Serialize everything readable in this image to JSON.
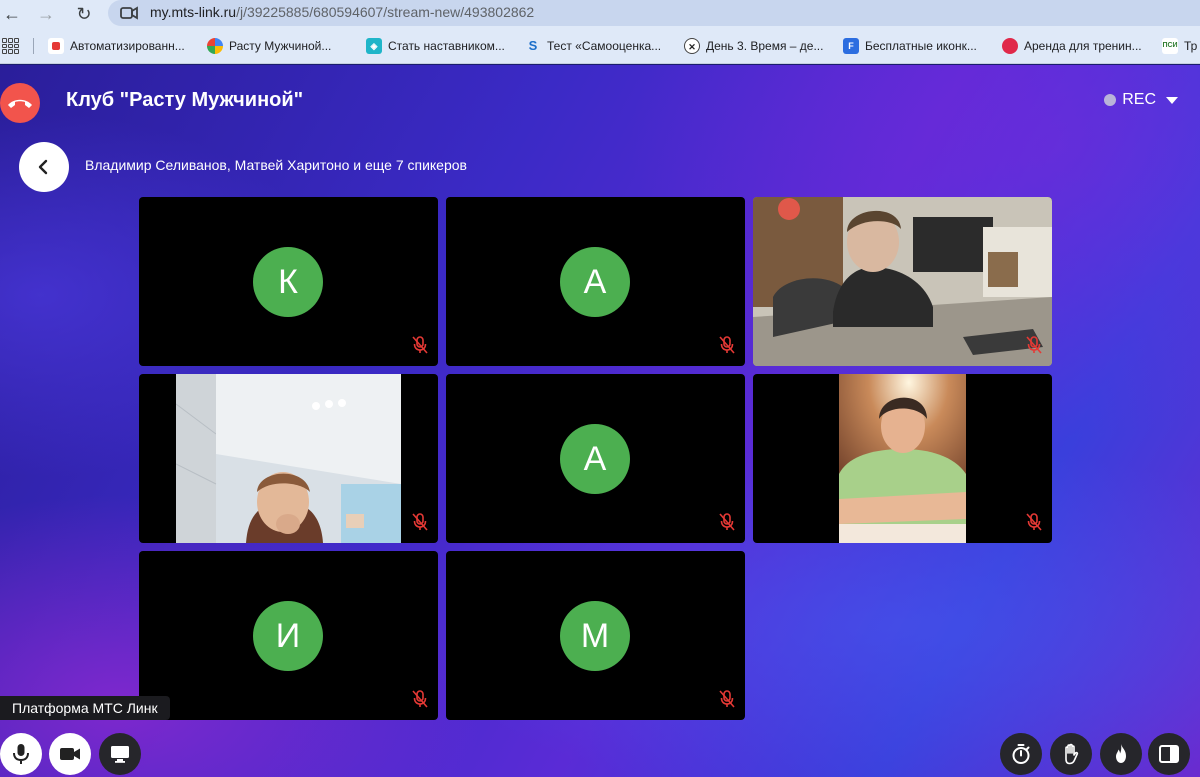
{
  "browser": {
    "url_host": "my.mts-link.ru",
    "url_path": "/j/39225885/680594607/stream-new/493802862",
    "bookmarks": [
      {
        "label": "Автоматизированн...",
        "icon": "red-dot-icon",
        "color": "#e53935"
      },
      {
        "label": "Расту Мужчиной...",
        "icon": "colorful-circle-icon",
        "color": "#4285f4"
      },
      {
        "label": "Стать наставником...",
        "icon": "cyan-logo-icon",
        "color": "#1fb5c9"
      },
      {
        "label": "Тест «Самооценка...",
        "icon": "s-logo-icon",
        "color": "#1c6fc9"
      },
      {
        "label": "День 3. Время – де...",
        "icon": "white-circle-icon",
        "color": "#ffffff"
      },
      {
        "label": "Бесплатные иконк...",
        "icon": "f-logo-icon",
        "color": "#2c6de0"
      },
      {
        "label": "Аренда для тренин...",
        "icon": "red-flower-icon",
        "color": "#e0284a"
      },
      {
        "label": "Тр",
        "icon": "psy-logo-icon",
        "color": "#2e7d32"
      }
    ]
  },
  "meeting": {
    "title": "Клуб \"Расту Мужчиной\"",
    "rec_label": "REC",
    "speakers_text": "Владимир Селиванов, Матвей Харитоно и еще 7 спикеров"
  },
  "tiles": [
    {
      "type": "avatar",
      "initial": "К",
      "muted": true
    },
    {
      "type": "avatar",
      "initial": "А",
      "muted": true
    },
    {
      "type": "video",
      "description": "boy-at-table-video",
      "muted": true
    },
    {
      "type": "video",
      "description": "boy-near-ceiling-video",
      "muted": true
    },
    {
      "type": "avatar",
      "initial": "А",
      "muted": true
    },
    {
      "type": "video",
      "description": "boy-arms-crossed-video",
      "muted": true
    },
    {
      "type": "avatar",
      "initial": "И",
      "muted": true
    },
    {
      "type": "avatar",
      "initial": "М",
      "muted": true
    }
  ],
  "footer": {
    "platform_label": "Платформа МТС Линк"
  },
  "colors": {
    "avatar_green": "#4caf50",
    "hangup_red": "#f2544c",
    "muted_red": "#e53935"
  }
}
